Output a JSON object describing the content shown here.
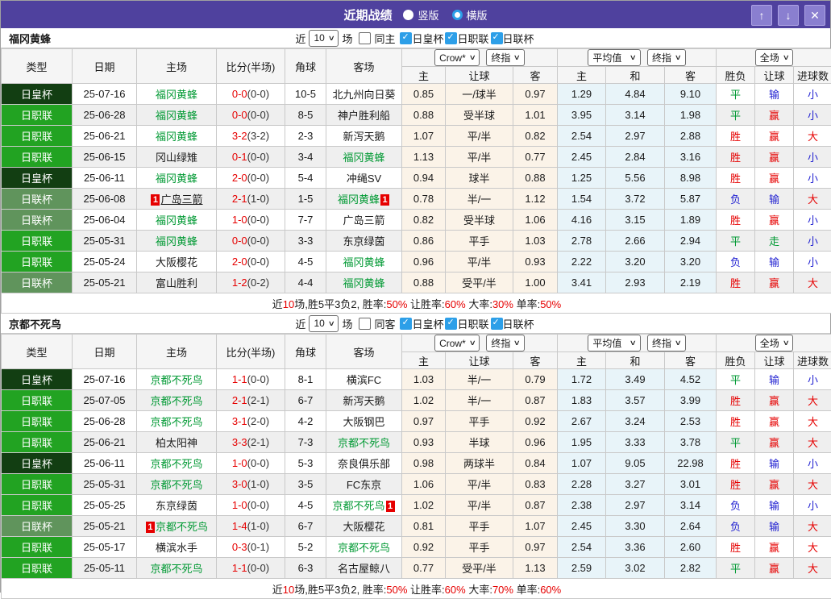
{
  "titlebar": {
    "title": "近期战绩",
    "radios": [
      {
        "label": "竖版",
        "checked": false
      },
      {
        "label": "横版",
        "checked": true
      }
    ],
    "buttons": {
      "up": "↑",
      "down": "↓",
      "close": "✕"
    }
  },
  "filter": {
    "prefix": "近",
    "count": "10",
    "suffix": "场"
  },
  "columns": {
    "type": "类型",
    "date": "日期",
    "home": "主场",
    "score": "比分(半场)",
    "corner": "角球",
    "away": "客场",
    "sub": [
      "主",
      "让球",
      "客",
      "主",
      "和",
      "客",
      "胜负",
      "让球",
      "进球数"
    ],
    "selects": {
      "crow": "Crow*",
      "final1": "终指",
      "avg": "平均值",
      "final2": "终指",
      "period": "全场"
    }
  },
  "type_styles": {
    "日皇杯": "#123E12",
    "日职联": "#22A322",
    "日联杯": "#60945C"
  },
  "result_colors": {
    "r": "#E60000",
    "g": "#009933",
    "b": "#1F1FD1",
    "k": "#1a1a1a"
  },
  "sections": [
    {
      "team": "福冈黄蜂",
      "same_label": "同主",
      "same_checked": false,
      "cups": [
        {
          "label": "日皇杯",
          "checked": true
        },
        {
          "label": "日职联",
          "checked": true
        },
        {
          "label": "日联杯",
          "checked": true
        }
      ],
      "rows": [
        {
          "type": "日皇杯",
          "date": "25-07-16",
          "home": {
            "name": "福冈黄蜂",
            "team": true
          },
          "score": "0-0",
          "half": "(0-0)",
          "corners": "10-5",
          "away": {
            "name": "北九州向日葵",
            "team": false
          },
          "crow": [
            "0.85",
            "一/球半",
            "0.97"
          ],
          "avg": [
            "1.29",
            "4.84",
            "9.10"
          ],
          "res": [
            [
              "平",
              "g"
            ],
            [
              "输",
              "b"
            ],
            [
              "小",
              "b"
            ]
          ]
        },
        {
          "type": "日职联",
          "date": "25-06-28",
          "home": {
            "name": "福冈黄蜂",
            "team": true
          },
          "score": "0-0",
          "half": "(0-0)",
          "corners": "8-5",
          "away": {
            "name": "神户胜利船",
            "team": false
          },
          "crow": [
            "0.88",
            "受半球",
            "1.01"
          ],
          "avg": [
            "3.95",
            "3.14",
            "1.98"
          ],
          "res": [
            [
              "平",
              "g"
            ],
            [
              "赢",
              "r"
            ],
            [
              "小",
              "b"
            ]
          ]
        },
        {
          "type": "日职联",
          "date": "25-06-21",
          "home": {
            "name": "福冈黄蜂",
            "team": true
          },
          "score": "3-2",
          "half": "(3-2)",
          "corners": "2-3",
          "away": {
            "name": "新泻天鹅",
            "team": false
          },
          "crow": [
            "1.07",
            "平/半",
            "0.82"
          ],
          "avg": [
            "2.54",
            "2.97",
            "2.88"
          ],
          "res": [
            [
              "胜",
              "r"
            ],
            [
              "赢",
              "r"
            ],
            [
              "大",
              "r"
            ]
          ]
        },
        {
          "type": "日职联",
          "date": "25-06-15",
          "home": {
            "name": "冈山绿雉",
            "team": false
          },
          "score": "0-1",
          "half": "(0-0)",
          "corners": "3-4",
          "away": {
            "name": "福冈黄蜂",
            "team": true
          },
          "crow": [
            "1.13",
            "平/半",
            "0.77"
          ],
          "avg": [
            "2.45",
            "2.84",
            "3.16"
          ],
          "res": [
            [
              "胜",
              "r"
            ],
            [
              "赢",
              "r"
            ],
            [
              "小",
              "b"
            ]
          ]
        },
        {
          "type": "日皇杯",
          "date": "25-06-11",
          "home": {
            "name": "福冈黄蜂",
            "team": true
          },
          "score": "2-0",
          "half": "(0-0)",
          "corners": "5-4",
          "away": {
            "name": "冲绳SV",
            "team": false
          },
          "crow": [
            "0.94",
            "球半",
            "0.88"
          ],
          "avg": [
            "1.25",
            "5.56",
            "8.98"
          ],
          "res": [
            [
              "胜",
              "r"
            ],
            [
              "赢",
              "r"
            ],
            [
              "小",
              "b"
            ]
          ]
        },
        {
          "type": "日联杯",
          "date": "25-06-08",
          "home": {
            "name": "广岛三箭",
            "team": false,
            "badge_pre": "1",
            "underline": true
          },
          "score": "2-1",
          "half": "(1-0)",
          "corners": "1-5",
          "away": {
            "name": "福冈黄蜂",
            "team": true,
            "badge_post": "1"
          },
          "crow": [
            "0.78",
            "半/一",
            "1.12"
          ],
          "avg": [
            "1.54",
            "3.72",
            "5.87"
          ],
          "res": [
            [
              "负",
              "b"
            ],
            [
              "输",
              "b"
            ],
            [
              "大",
              "r"
            ]
          ]
        },
        {
          "type": "日联杯",
          "date": "25-06-04",
          "home": {
            "name": "福冈黄蜂",
            "team": true
          },
          "score": "1-0",
          "half": "(0-0)",
          "corners": "7-7",
          "away": {
            "name": "广岛三箭",
            "team": false
          },
          "crow": [
            "0.82",
            "受半球",
            "1.06"
          ],
          "avg": [
            "4.16",
            "3.15",
            "1.89"
          ],
          "res": [
            [
              "胜",
              "r"
            ],
            [
              "赢",
              "r"
            ],
            [
              "小",
              "b"
            ]
          ]
        },
        {
          "type": "日职联",
          "date": "25-05-31",
          "home": {
            "name": "福冈黄蜂",
            "team": true
          },
          "score": "0-0",
          "half": "(0-0)",
          "corners": "3-3",
          "away": {
            "name": "东京绿茵",
            "team": false
          },
          "crow": [
            "0.86",
            "平手",
            "1.03"
          ],
          "avg": [
            "2.78",
            "2.66",
            "2.94"
          ],
          "res": [
            [
              "平",
              "g"
            ],
            [
              "走",
              "g"
            ],
            [
              "小",
              "b"
            ]
          ]
        },
        {
          "type": "日职联",
          "date": "25-05-24",
          "home": {
            "name": "大阪樱花",
            "team": false
          },
          "score": "2-0",
          "half": "(0-0)",
          "corners": "4-5",
          "away": {
            "name": "福冈黄蜂",
            "team": true
          },
          "crow": [
            "0.96",
            "平/半",
            "0.93"
          ],
          "avg": [
            "2.22",
            "3.20",
            "3.20"
          ],
          "res": [
            [
              "负",
              "b"
            ],
            [
              "输",
              "b"
            ],
            [
              "小",
              "b"
            ]
          ]
        },
        {
          "type": "日联杯",
          "date": "25-05-21",
          "home": {
            "name": "富山胜利",
            "team": false
          },
          "score": "1-2",
          "half": "(0-2)",
          "corners": "4-4",
          "away": {
            "name": "福冈黄蜂",
            "team": true
          },
          "crow": [
            "0.88",
            "受平/半",
            "1.00"
          ],
          "avg": [
            "3.41",
            "2.93",
            "2.19"
          ],
          "res": [
            [
              "胜",
              "r"
            ],
            [
              "赢",
              "r"
            ],
            [
              "大",
              "r"
            ]
          ]
        }
      ],
      "summary": [
        [
          "近",
          "k"
        ],
        [
          "10",
          "r"
        ],
        [
          "场,胜5平3负2, 胜率:",
          "k"
        ],
        [
          "50%",
          "r"
        ],
        [
          " 让胜率:",
          "k"
        ],
        [
          "60%",
          "r"
        ],
        [
          " 大率:",
          "k"
        ],
        [
          "30%",
          "r"
        ],
        [
          " 单率:",
          "k"
        ],
        [
          "50%",
          "r"
        ]
      ]
    },
    {
      "team": "京都不死鸟",
      "same_label": "同客",
      "same_checked": false,
      "cups": [
        {
          "label": "日皇杯",
          "checked": true
        },
        {
          "label": "日职联",
          "checked": true
        },
        {
          "label": "日联杯",
          "checked": true
        }
      ],
      "rows": [
        {
          "type": "日皇杯",
          "date": "25-07-16",
          "home": {
            "name": "京都不死鸟",
            "team": true
          },
          "score": "1-1",
          "half": "(0-0)",
          "corners": "8-1",
          "away": {
            "name": "横滨FC",
            "team": false
          },
          "crow": [
            "1.03",
            "半/一",
            "0.79"
          ],
          "avg": [
            "1.72",
            "3.49",
            "4.52"
          ],
          "res": [
            [
              "平",
              "g"
            ],
            [
              "输",
              "b"
            ],
            [
              "小",
              "b"
            ]
          ]
        },
        {
          "type": "日职联",
          "date": "25-07-05",
          "home": {
            "name": "京都不死鸟",
            "team": true
          },
          "score": "2-1",
          "half": "(2-1)",
          "corners": "6-7",
          "away": {
            "name": "新泻天鹅",
            "team": false
          },
          "crow": [
            "1.02",
            "半/一",
            "0.87"
          ],
          "avg": [
            "1.83",
            "3.57",
            "3.99"
          ],
          "res": [
            [
              "胜",
              "r"
            ],
            [
              "赢",
              "r"
            ],
            [
              "大",
              "r"
            ]
          ]
        },
        {
          "type": "日职联",
          "date": "25-06-28",
          "home": {
            "name": "京都不死鸟",
            "team": true
          },
          "score": "3-1",
          "half": "(2-0)",
          "corners": "4-2",
          "away": {
            "name": "大阪钢巴",
            "team": false
          },
          "crow": [
            "0.97",
            "平手",
            "0.92"
          ],
          "avg": [
            "2.67",
            "3.24",
            "2.53"
          ],
          "res": [
            [
              "胜",
              "r"
            ],
            [
              "赢",
              "r"
            ],
            [
              "大",
              "r"
            ]
          ]
        },
        {
          "type": "日职联",
          "date": "25-06-21",
          "home": {
            "name": "柏太阳神",
            "team": false
          },
          "score": "3-3",
          "half": "(2-1)",
          "corners": "7-3",
          "away": {
            "name": "京都不死鸟",
            "team": true
          },
          "crow": [
            "0.93",
            "半球",
            "0.96"
          ],
          "avg": [
            "1.95",
            "3.33",
            "3.78"
          ],
          "res": [
            [
              "平",
              "g"
            ],
            [
              "赢",
              "r"
            ],
            [
              "大",
              "r"
            ]
          ]
        },
        {
          "type": "日皇杯",
          "date": "25-06-11",
          "home": {
            "name": "京都不死鸟",
            "team": true
          },
          "score": "1-0",
          "half": "(0-0)",
          "corners": "5-3",
          "away": {
            "name": "奈良俱乐部",
            "team": false
          },
          "crow": [
            "0.98",
            "两球半",
            "0.84"
          ],
          "avg": [
            "1.07",
            "9.05",
            "22.98"
          ],
          "res": [
            [
              "胜",
              "r"
            ],
            [
              "输",
              "b"
            ],
            [
              "小",
              "b"
            ]
          ]
        },
        {
          "type": "日职联",
          "date": "25-05-31",
          "home": {
            "name": "京都不死鸟",
            "team": true
          },
          "score": "3-0",
          "half": "(1-0)",
          "corners": "3-5",
          "away": {
            "name": "FC东京",
            "team": false
          },
          "crow": [
            "1.06",
            "平/半",
            "0.83"
          ],
          "avg": [
            "2.28",
            "3.27",
            "3.01"
          ],
          "res": [
            [
              "胜",
              "r"
            ],
            [
              "赢",
              "r"
            ],
            [
              "大",
              "r"
            ]
          ]
        },
        {
          "type": "日职联",
          "date": "25-05-25",
          "home": {
            "name": "东京绿茵",
            "team": false
          },
          "score": "1-0",
          "half": "(0-0)",
          "corners": "4-5",
          "away": {
            "name": "京都不死鸟",
            "team": true,
            "badge_post": "1"
          },
          "crow": [
            "1.02",
            "平/半",
            "0.87"
          ],
          "avg": [
            "2.38",
            "2.97",
            "3.14"
          ],
          "res": [
            [
              "负",
              "b"
            ],
            [
              "输",
              "b"
            ],
            [
              "小",
              "b"
            ]
          ]
        },
        {
          "type": "日联杯",
          "date": "25-05-21",
          "home": {
            "name": "京都不死鸟",
            "team": true,
            "badge_pre": "1"
          },
          "score": "1-4",
          "half": "(1-0)",
          "corners": "6-7",
          "away": {
            "name": "大阪樱花",
            "team": false
          },
          "crow": [
            "0.81",
            "平手",
            "1.07"
          ],
          "avg": [
            "2.45",
            "3.30",
            "2.64"
          ],
          "res": [
            [
              "负",
              "b"
            ],
            [
              "输",
              "b"
            ],
            [
              "大",
              "r"
            ]
          ]
        },
        {
          "type": "日职联",
          "date": "25-05-17",
          "home": {
            "name": "横滨水手",
            "team": false
          },
          "score": "0-3",
          "half": "(0-1)",
          "corners": "5-2",
          "away": {
            "name": "京都不死鸟",
            "team": true
          },
          "crow": [
            "0.92",
            "平手",
            "0.97"
          ],
          "avg": [
            "2.54",
            "3.36",
            "2.60"
          ],
          "res": [
            [
              "胜",
              "r"
            ],
            [
              "赢",
              "r"
            ],
            [
              "大",
              "r"
            ]
          ]
        },
        {
          "type": "日职联",
          "date": "25-05-11",
          "home": {
            "name": "京都不死鸟",
            "team": true
          },
          "score": "1-1",
          "half": "(0-0)",
          "corners": "6-3",
          "away": {
            "name": "名古屋鲸八",
            "team": false
          },
          "crow": [
            "0.77",
            "受平/半",
            "1.13"
          ],
          "avg": [
            "2.59",
            "3.02",
            "2.82"
          ],
          "res": [
            [
              "平",
              "g"
            ],
            [
              "赢",
              "r"
            ],
            [
              "大",
              "r"
            ]
          ]
        }
      ],
      "summary": [
        [
          "近",
          "k"
        ],
        [
          "10",
          "r"
        ],
        [
          "场,胜5平3负2, 胜率:",
          "k"
        ],
        [
          "50%",
          "r"
        ],
        [
          " 让胜率:",
          "k"
        ],
        [
          "60%",
          "r"
        ],
        [
          " 大率:",
          "k"
        ],
        [
          "70%",
          "r"
        ],
        [
          " 单率:",
          "k"
        ],
        [
          "60%",
          "r"
        ]
      ]
    }
  ]
}
